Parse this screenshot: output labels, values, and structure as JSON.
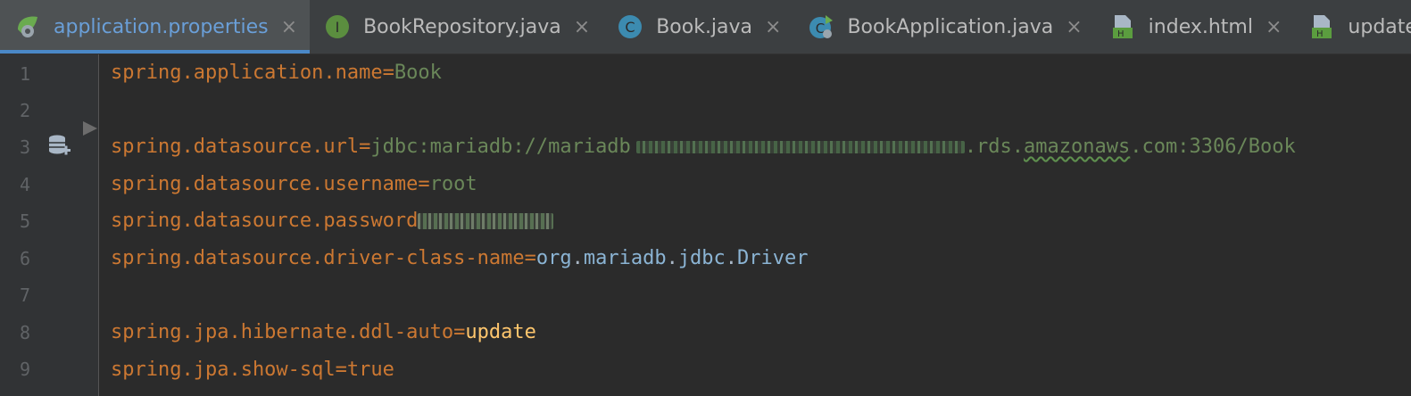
{
  "tabs": [
    {
      "label": "application.properties",
      "icon": "spring-properties-icon",
      "active": true,
      "close": "×"
    },
    {
      "label": "BookRepository.java",
      "icon": "interface-icon",
      "active": false,
      "close": "×"
    },
    {
      "label": "Book.java",
      "icon": "class-icon",
      "active": false,
      "close": "×"
    },
    {
      "label": "BookApplication.java",
      "icon": "spring-boot-class-icon",
      "active": false,
      "close": "×"
    },
    {
      "label": "index.html",
      "icon": "html-file-icon",
      "active": false,
      "close": "×"
    },
    {
      "label": "updateBook",
      "icon": "html-file-icon",
      "active": false,
      "close": ""
    }
  ],
  "line_numbers": [
    "1",
    "2",
    "3",
    "4",
    "5",
    "6",
    "7",
    "8",
    "9"
  ],
  "code": {
    "l1": {
      "key": "spring.application.name",
      "eq": "=",
      "value": "Book"
    },
    "l3": {
      "key": "spring.datasource.url",
      "eq": "=",
      "value_prefix": "jdbc:mariadb://mariadb",
      "value_suffix_1": ".rds.",
      "value_suffix_squiggle": "amazonaws",
      "value_suffix_2": ".com:3306/Book"
    },
    "l4": {
      "key": "spring.datasource.username",
      "eq": "=",
      "value": "root"
    },
    "l5": {
      "key": "spring.datasource.password"
    },
    "l6": {
      "key": "spring.datasource.driver-class-name",
      "eq": "=",
      "v1": "org",
      "d1": ".",
      "v2": "mariadb",
      "d2": ".",
      "v3": "jdbc",
      "d3": ".",
      "v4": "Driver"
    },
    "l8": {
      "key": "spring.jpa.hibernate.ddl-auto",
      "eq": "=",
      "value": "update"
    },
    "l9": {
      "key": "spring.jpa.show-sql",
      "eq": "=",
      "value": "true"
    }
  },
  "colors": {
    "key": "#cc7832",
    "string_value": "#6a8759",
    "yellow_value": "#ffc66d",
    "active_tab_text": "#6a9fd8",
    "accent": "#4a88c7"
  }
}
